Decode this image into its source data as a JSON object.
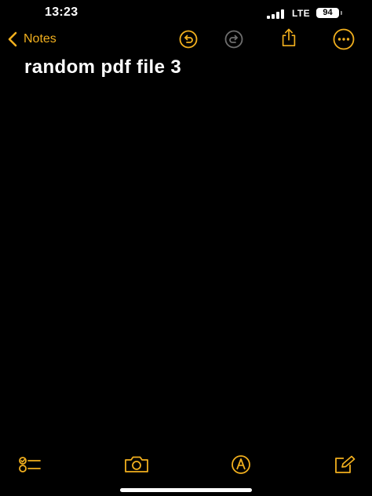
{
  "status_bar": {
    "time": "13:23",
    "network": "LTE",
    "battery": "94"
  },
  "nav": {
    "back_label": "Notes",
    "icons": [
      "chevron-left-icon",
      "undo-icon",
      "redo-icon",
      "share-icon",
      "more-icon"
    ]
  },
  "note": {
    "title": "random pdf file 3",
    "body": ""
  },
  "toolbar": {
    "icons": [
      "checklist-icon",
      "camera-icon",
      "markup-pen-icon",
      "compose-icon"
    ]
  },
  "colors": {
    "accent": "#f2b01e",
    "background": "#000000",
    "disabled": "#6e6e6e",
    "text": "#ffffff"
  }
}
